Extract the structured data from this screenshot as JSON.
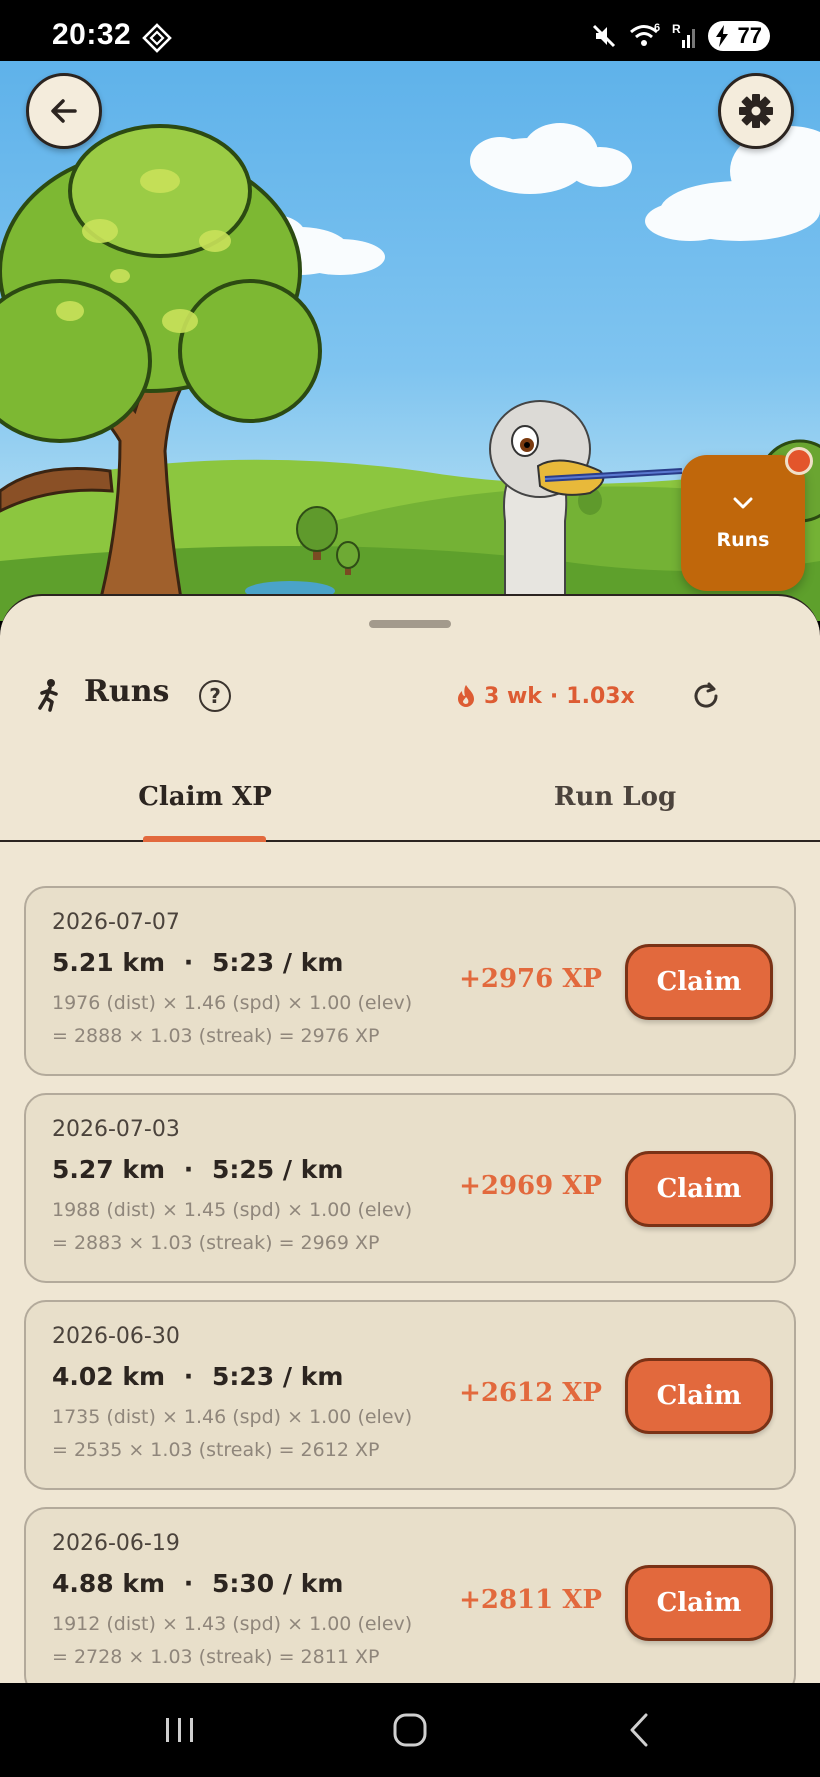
{
  "status_bar": {
    "time": "20:32",
    "battery": "77",
    "signal_label": "R",
    "wifi_label": "6"
  },
  "scene": {
    "runs_fab_label": "Runs"
  },
  "header": {
    "title": "Runs",
    "help": "?",
    "streak": "3 wk",
    "separator": "·",
    "multiplier": "1.03x"
  },
  "tabs": [
    {
      "label": "Claim XP",
      "active": true
    },
    {
      "label": "Run Log",
      "active": false
    }
  ],
  "runs": [
    {
      "date": "2026-07-07",
      "distance": "5.21 km",
      "separator": "·",
      "pace": "5:23 / km",
      "formula_line1": "1976 (dist) × 1.46 (spd) × 1.00 (elev)",
      "formula_line2": "= 2888 × 1.03 (streak) = 2976 XP",
      "xp": "+2976 XP",
      "button": "Claim"
    },
    {
      "date": "2026-07-03",
      "distance": "5.27 km",
      "separator": "·",
      "pace": "5:25 / km",
      "formula_line1": "1988 (dist) × 1.45 (spd) × 1.00 (elev)",
      "formula_line2": "= 2883 × 1.03 (streak) = 2969 XP",
      "xp": "+2969 XP",
      "button": "Claim"
    },
    {
      "date": "2026-06-30",
      "distance": "4.02 km",
      "separator": "·",
      "pace": "5:23 / km",
      "formula_line1": "1735 (dist) × 1.46 (spd) × 1.00 (elev)",
      "formula_line2": "= 2535 × 1.03 (streak) = 2612 XP",
      "xp": "+2612 XP",
      "button": "Claim"
    },
    {
      "date": "2026-06-19",
      "distance": "4.88 km",
      "separator": "·",
      "pace": "5:30 / km",
      "formula_line1": "1912 (dist) × 1.43 (spd) × 1.00 (elev)",
      "formula_line2": "= 2728 × 1.03 (streak) = 2811 XP",
      "xp": "+2811 XP",
      "button": "Claim"
    }
  ],
  "colors": {
    "accent": "#e2693d",
    "fab": "#c0670b",
    "sheet": "#efe6d3",
    "card": "#e8dfca",
    "text": "#2c2520"
  }
}
